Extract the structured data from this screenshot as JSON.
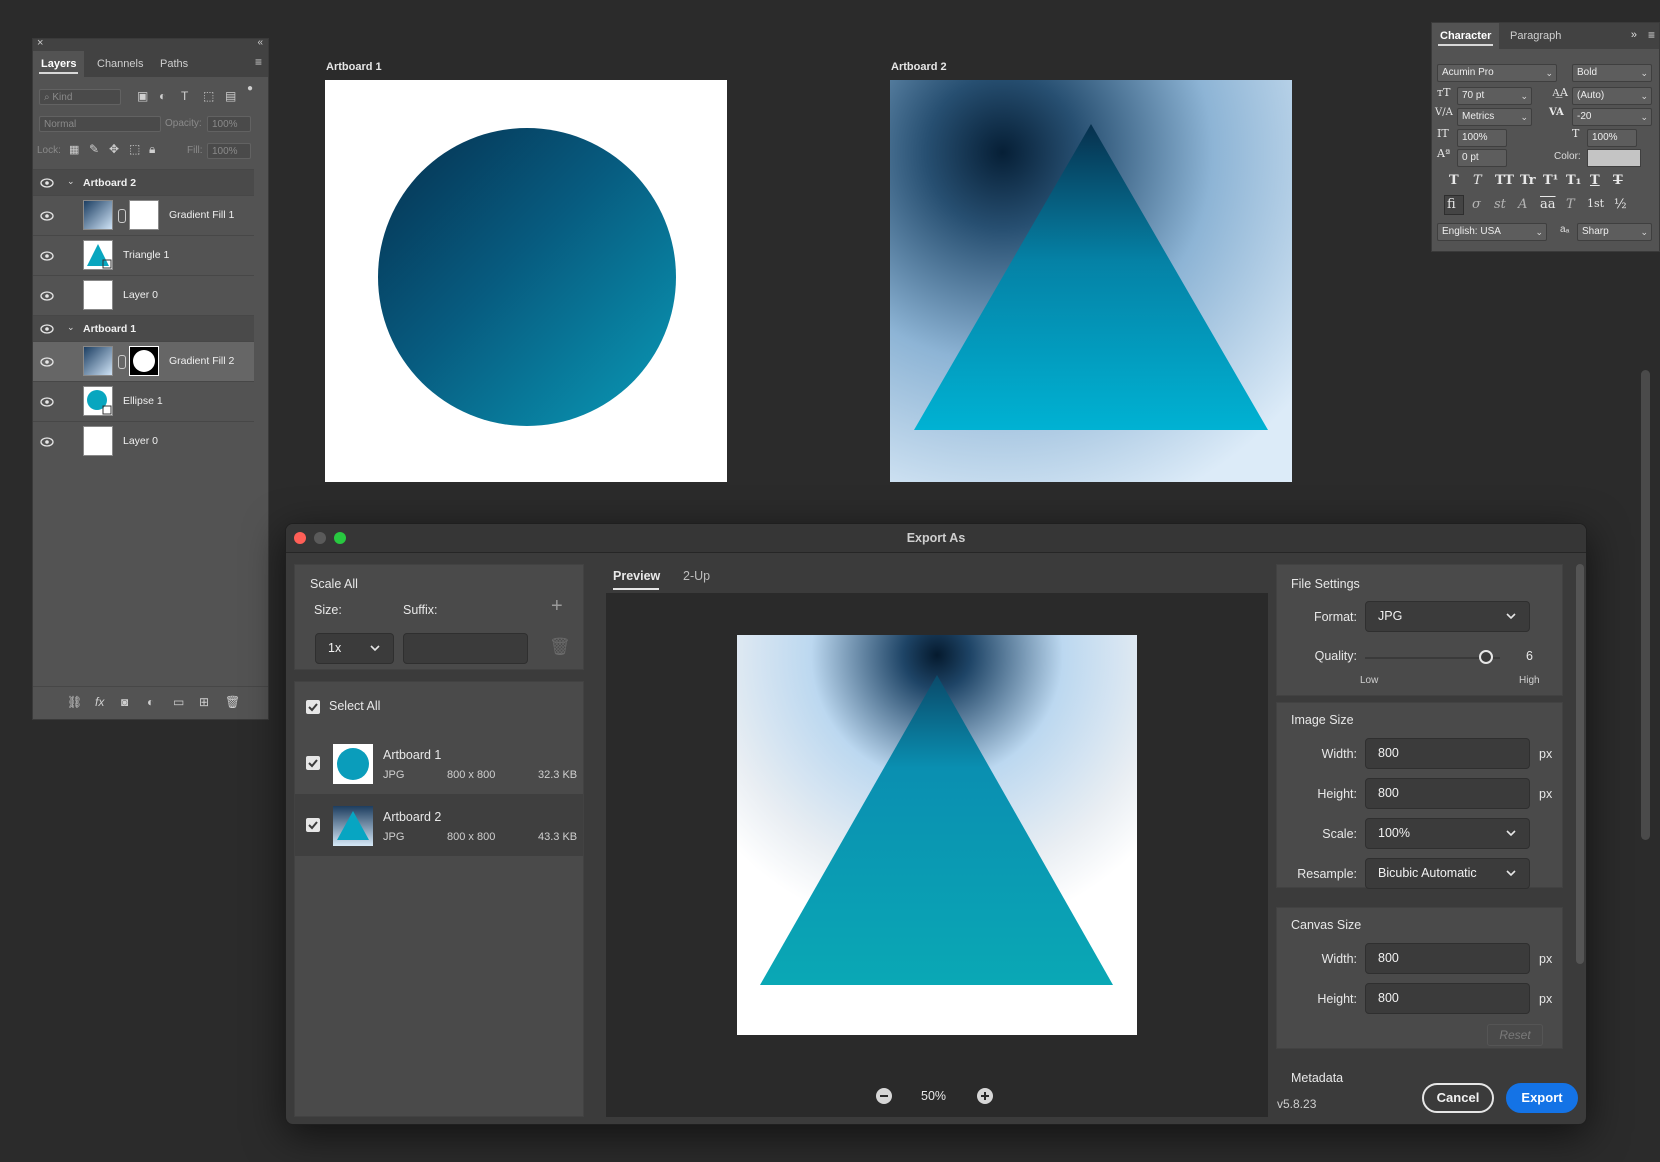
{
  "layers_panel": {
    "tabs": [
      "Layers",
      "Channels",
      "Paths"
    ],
    "filter_placeholder": "Kind",
    "blend_mode": "Normal",
    "opacity_label": "Opacity:",
    "opacity_value": "100%",
    "lock_label": "Lock:",
    "fill_label": "Fill:",
    "fill_value": "100%",
    "rows": [
      {
        "name": "Artboard 2",
        "type": "group"
      },
      {
        "name": "Gradient Fill 1",
        "type": "fill"
      },
      {
        "name": "Triangle 1",
        "type": "shape"
      },
      {
        "name": "Layer 0",
        "type": "pixel"
      },
      {
        "name": "Artboard 1",
        "type": "group"
      },
      {
        "name": "Gradient Fill 2",
        "type": "fill",
        "selected": true
      },
      {
        "name": "Ellipse 1",
        "type": "shape"
      },
      {
        "name": "Layer 0",
        "type": "pixel"
      }
    ]
  },
  "artboards": {
    "ab1_label": "Artboard 1",
    "ab2_label": "Artboard 2"
  },
  "character_panel": {
    "tabs": [
      "Character",
      "Paragraph"
    ],
    "font_family": "Acumin Pro",
    "font_style": "Bold",
    "font_size": "70 pt",
    "leading": "(Auto)",
    "kerning": "Metrics",
    "tracking": "-20",
    "vertical_scale": "100%",
    "horizontal_scale": "100%",
    "baseline_shift": "0 pt",
    "color_label": "Color:",
    "language": "English: USA",
    "antialias_icon": "aₐ",
    "antialias": "Sharp",
    "style_buttons": [
      "T",
      "T",
      "TT",
      "Tr",
      "T¹",
      "T₁",
      "T",
      "T"
    ],
    "opentype_buttons": [
      "fi",
      "σ",
      "st",
      "A",
      "aa",
      "T",
      "1st",
      "½"
    ]
  },
  "export_dialog": {
    "title": "Export As",
    "scale_all": "Scale All",
    "size_label": "Size:",
    "suffix_label": "Suffix:",
    "size_value": "1x",
    "select_all": "Select All",
    "items": [
      {
        "name": "Artboard 1",
        "format": "JPG",
        "dims": "800 x 800",
        "filesize": "32.3 KB"
      },
      {
        "name": "Artboard 2",
        "format": "JPG",
        "dims": "800 x 800",
        "filesize": "43.3 KB"
      }
    ],
    "preview_tabs": [
      "Preview",
      "2-Up"
    ],
    "zoom": "50%",
    "file_settings": {
      "title": "File Settings",
      "format_label": "Format:",
      "format_value": "JPG",
      "quality_label": "Quality:",
      "quality_value": "6",
      "quality_fraction": 0.6,
      "low": "Low",
      "high": "High"
    },
    "image_size": {
      "title": "Image Size",
      "width_label": "Width:",
      "width": "800",
      "height_label": "Height:",
      "height": "800",
      "unit": "px",
      "scale_label": "Scale:",
      "scale": "100%",
      "resample_label": "Resample:",
      "resample": "Bicubic Automatic"
    },
    "canvas_size": {
      "title": "Canvas Size",
      "width_label": "Width:",
      "width": "800",
      "height_label": "Height:",
      "height": "800",
      "unit": "px",
      "reset": "Reset"
    },
    "metadata": "Metadata",
    "version": "v5.8.23",
    "cancel": "Cancel",
    "export": "Export"
  },
  "colors": {
    "app_bg": "#2b2b2b",
    "panel_bg": "#535353",
    "accent_blue": "#1473e6",
    "teal": "#00a7c4",
    "navy": "#0b2a48"
  }
}
